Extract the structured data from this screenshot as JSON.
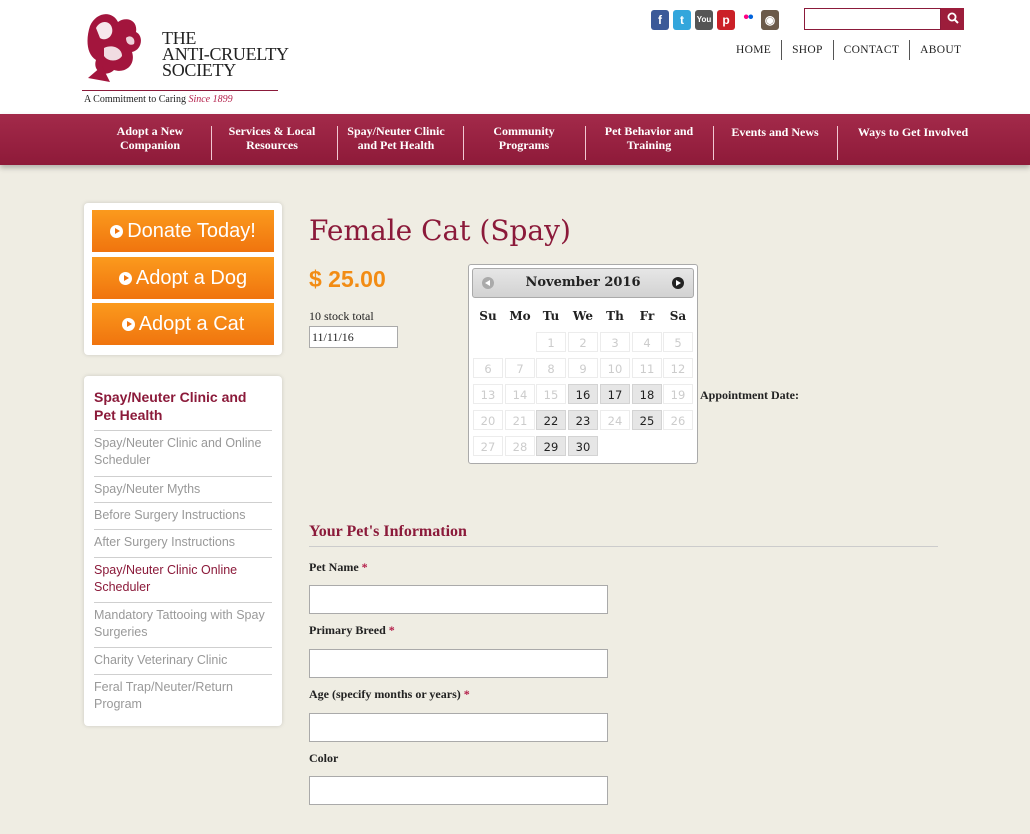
{
  "header": {
    "logo": {
      "line1": "THE",
      "line2": "ANTI-CRUELTY",
      "line3": "SOCIETY",
      "tagline": "A Commitment to Caring",
      "since": "Since 1899"
    },
    "social_icons": [
      "facebook-icon",
      "twitter-icon",
      "youtube-icon",
      "pinterest-icon",
      "flickr-icon",
      "instagram-icon"
    ],
    "search": {
      "placeholder": "",
      "value": ""
    },
    "top_links": [
      "HOME",
      "SHOP",
      "CONTACT",
      "ABOUT"
    ]
  },
  "nav": {
    "items": [
      {
        "line1": "Adopt a New",
        "line2": "Companion"
      },
      {
        "line1": "Services & Local",
        "line2": "Resources"
      },
      {
        "line1": "Spay/Neuter Clinic",
        "line2": "and Pet Health"
      },
      {
        "line1": "Community",
        "line2": "Programs"
      },
      {
        "line1": "Pet Behavior and",
        "line2": "Training"
      },
      {
        "line1": "Events and News",
        "line2": ""
      },
      {
        "line1": "Ways to Get Involved",
        "line2": ""
      }
    ]
  },
  "sidebar": {
    "cta": [
      "Donate Today!",
      "Adopt a Dog",
      "Adopt a Cat"
    ],
    "subnav_title": "Spay/Neuter Clinic and Pet Health",
    "subnav_items": [
      "Spay/Neuter Clinic and Online Scheduler",
      "Spay/Neuter Myths",
      "Before Surgery Instructions",
      "After Surgery Instructions",
      "Spay/Neuter Clinic Online Scheduler",
      "Mandatory Tattooing with Spay Surgeries",
      "Charity Veterinary Clinic",
      "Feral Trap/Neuter/Return Program"
    ]
  },
  "product": {
    "title": "Female Cat (Spay)",
    "price": "$ 25.00",
    "stock": "10 stock total",
    "date_value": "11/11/16"
  },
  "calendar": {
    "month_label": "November 2016",
    "weekdays": [
      "Su",
      "Mo",
      "Tu",
      "We",
      "Th",
      "Fr",
      "Sa"
    ],
    "first_weekday": 2,
    "days_in_month": 30,
    "available_days": [
      16,
      17,
      18,
      22,
      23,
      25,
      29,
      30
    ]
  },
  "appointment_label": "Appointment Date:",
  "pet_info": {
    "section_title": "Your Pet's Information",
    "fields": [
      {
        "label": "Pet Name",
        "required": "*"
      },
      {
        "label": "Primary Breed",
        "required": "*"
      },
      {
        "label": "Age (specify months or years)",
        "required": "*"
      },
      {
        "label": "Color",
        "required": ""
      }
    ]
  }
}
